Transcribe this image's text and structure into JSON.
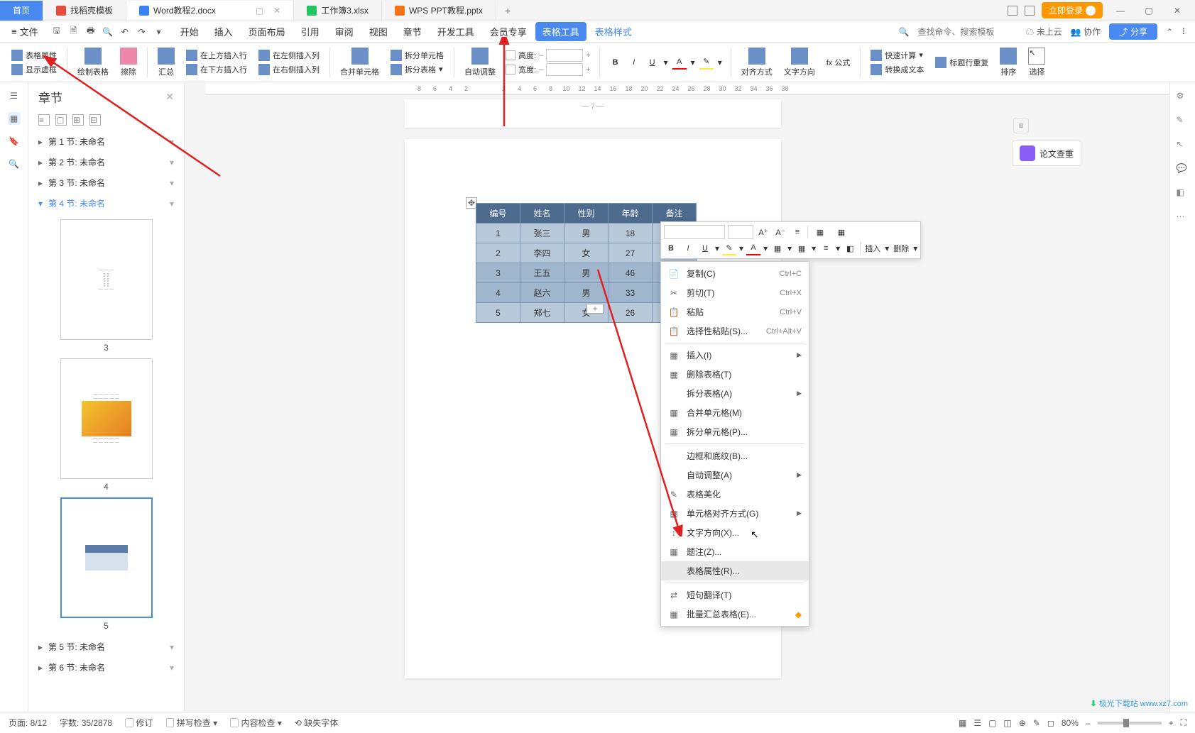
{
  "tabs": {
    "home": "首页",
    "items": [
      {
        "label": "找稻壳模板"
      },
      {
        "label": "Word教程2.docx"
      },
      {
        "label": "工作簿3.xlsx"
      },
      {
        "label": "WPS PPT教程.pptx"
      }
    ],
    "login": "立即登录"
  },
  "menu": {
    "file": "文件",
    "tabs": [
      "开始",
      "插入",
      "页面布局",
      "引用",
      "审阅",
      "视图",
      "章节",
      "开发工具",
      "会员专享",
      "表格工具",
      "表格样式"
    ],
    "active_index": 9,
    "search_placeholder": "查找命令、搜索模板",
    "cloud": "未上云",
    "coop": "协作",
    "share": "分享"
  },
  "ribbon": {
    "table_props": "表格属性",
    "show_grid": "显示虚框",
    "draw_table": "绘制表格",
    "erase": "擦除",
    "summary": "汇总",
    "insert_above": "在上方插入行",
    "insert_below": "在下方插入行",
    "insert_left": "在左侧插入列",
    "insert_right": "在右侧插入列",
    "merge": "合并单元格",
    "split_cell": "拆分单元格",
    "split_table": "拆分表格",
    "auto_fit": "自动调整",
    "height": "高度:",
    "width": "宽度:",
    "align": "对齐方式",
    "text_dir": "文字方向",
    "formula": "fx 公式",
    "quick_calc": "快速计算",
    "header_repeat": "标题行重复",
    "to_text": "转换成文本",
    "sort": "排序",
    "select": "选择"
  },
  "nav": {
    "title": "章节",
    "items": [
      {
        "label": "第 1 节: 未命名"
      },
      {
        "label": "第 2 节: 未命名"
      },
      {
        "label": "第 3 节: 未命名"
      },
      {
        "label": "第 4 节: 未命名"
      },
      {
        "label": "第 5 节: 未命名"
      },
      {
        "label": "第 6 节: 未命名"
      }
    ],
    "thumbs": [
      "3",
      "4",
      "5"
    ]
  },
  "ruler": [
    "8",
    "6",
    "4",
    "2",
    "2",
    "4",
    "6",
    "8",
    "10",
    "12",
    "14",
    "16",
    "18",
    "20",
    "22",
    "24",
    "26",
    "28",
    "30",
    "32",
    "34",
    "36",
    "38"
  ],
  "page_stub": "— 7 —",
  "table": {
    "headers": [
      "编号",
      "姓名",
      "性别",
      "年龄",
      "备注"
    ],
    "rows": [
      [
        "1",
        "张三",
        "男",
        "18",
        ""
      ],
      [
        "2",
        "李四",
        "女",
        "27",
        ""
      ],
      [
        "3",
        "王五",
        "男",
        "46",
        ""
      ],
      [
        "4",
        "赵六",
        "男",
        "33",
        ""
      ],
      [
        "5",
        "郑七",
        "女",
        "26",
        ""
      ]
    ]
  },
  "paper_check": "论文查重",
  "mini_tb": {
    "bold": "B",
    "italic": "I",
    "underline": "U",
    "insert": "插入",
    "delete": "删除"
  },
  "ctx": [
    {
      "ico": "📄",
      "label": "复制(C)",
      "sh": "Ctrl+C"
    },
    {
      "ico": "✂",
      "label": "剪切(T)",
      "sh": "Ctrl+X"
    },
    {
      "ico": "📋",
      "label": "粘贴",
      "sh": "Ctrl+V"
    },
    {
      "ico": "📋",
      "label": "选择性粘贴(S)...",
      "sh": "Ctrl+Alt+V"
    },
    {
      "sep": true
    },
    {
      "ico": "▦",
      "label": "插入(I)",
      "sub": true
    },
    {
      "ico": "▦",
      "label": "删除表格(T)"
    },
    {
      "label": "拆分表格(A)",
      "sub": true
    },
    {
      "ico": "▦",
      "label": "合并单元格(M)"
    },
    {
      "ico": "▦",
      "label": "拆分单元格(P)..."
    },
    {
      "sep": true
    },
    {
      "label": "边框和底纹(B)..."
    },
    {
      "label": "自动调整(A)",
      "sub": true
    },
    {
      "ico": "✎",
      "label": "表格美化"
    },
    {
      "ico": "▦",
      "label": "单元格对齐方式(G)",
      "sub": true
    },
    {
      "ico": "↕",
      "label": "文字方向(X)..."
    },
    {
      "ico": "▦",
      "label": "题注(Z)..."
    },
    {
      "label": "表格属性(R)...",
      "hov": true
    },
    {
      "sep": true
    },
    {
      "ico": "⇄",
      "label": "短句翻译(T)"
    },
    {
      "ico": "▦",
      "label": "批量汇总表格(E)...",
      "badge": true
    }
  ],
  "status": {
    "page": "页面: 8/12",
    "words": "字数: 35/2878",
    "track": "修订",
    "spell": "拼写检查",
    "content": "内容检查",
    "missing": "缺失字体",
    "zoom": "80%"
  },
  "watermark": "极光下载站 www.xz7.com"
}
